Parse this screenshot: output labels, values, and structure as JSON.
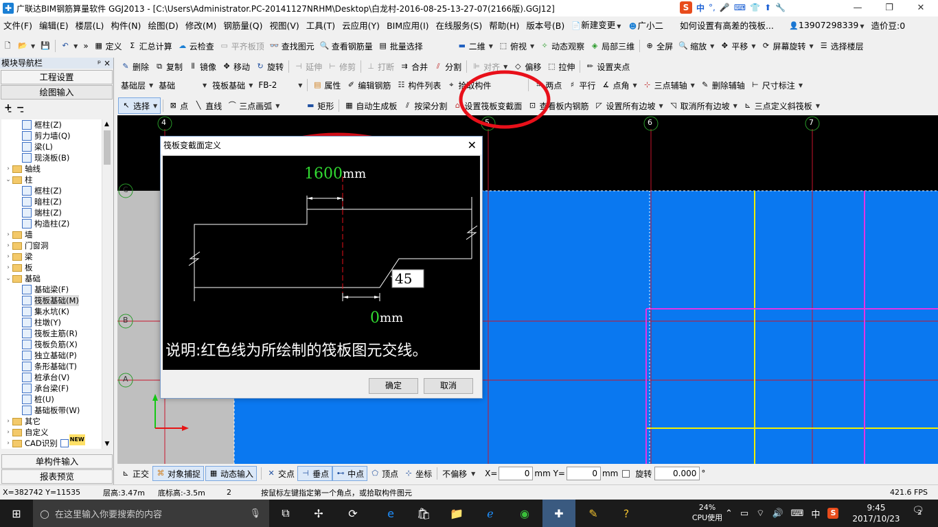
{
  "window": {
    "title": "广联达BIM钢筋算量软件 GGJ2013 - [C:\\Users\\Administrator.PC-20141127NRHM\\Desktop\\白龙村-2016-08-25-13-27-07(2166版).GGJ12]",
    "ime_label": "中"
  },
  "menu": {
    "items": [
      "文件(F)",
      "编辑(E)",
      "楼层(L)",
      "构件(N)",
      "绘图(D)",
      "修改(M)",
      "钢筋量(Q)",
      "视图(V)",
      "工具(T)",
      "云应用(Y)",
      "BIM应用(I)",
      "在线服务(S)",
      "帮助(H)",
      "版本号(B)"
    ],
    "new_change": "新建变更",
    "assistant": "广小二",
    "question": "如何设置有高差的筏板...",
    "phone": "13907298339",
    "price_bean": "造价豆:0"
  },
  "toolbar1": {
    "define": "定义",
    "sum_calc": "汇总计算",
    "cloud_check": "云检查",
    "flush_top": "平齐板顶",
    "find": "查找图元",
    "view_rebar": "查看钢筋量",
    "batch_select": "批量选择",
    "view_2d": "二维",
    "top_view": "俯视",
    "dynamic_view": "动态观察",
    "local_3d": "局部三维",
    "fullscreen": "全屏",
    "zoom": "缩放",
    "pan": "平移",
    "rotate_screen": "屏幕旋转",
    "select_floor": "选择楼层"
  },
  "toolbar2": {
    "delete": "删除",
    "copy": "复制",
    "mirror": "镜像",
    "move": "移动",
    "rotate": "旋转",
    "extend": "延伸",
    "trim": "修剪",
    "break": "打断",
    "merge": "合并",
    "split": "分割",
    "align": "对齐",
    "offset": "偏移",
    "stretch": "拉伸",
    "set_grip": "设置夹点"
  },
  "toolbar3": {
    "layer": "基础层",
    "category": "基础",
    "type": "筏板基础",
    "component": "FB-2",
    "properties": "属性",
    "edit_rebar": "编辑钢筋",
    "component_list": "构件列表",
    "pick_component": "拾取构件",
    "two_points": "两点",
    "parallel": "平行",
    "point_angle": "点角",
    "three_point_axis": "三点辅轴",
    "delete_axis": "删除辅轴",
    "dimension": "尺寸标注"
  },
  "toolbar4": {
    "select": "选择",
    "point": "点",
    "line": "直线",
    "arc3": "三点画弧",
    "rect": "矩形",
    "auto_gen": "自动生成板",
    "split_by": "按梁分割",
    "set_section": "设置筏板变截面",
    "view_slab_rebar": "查看板内钢筋",
    "set_all_slopes": "设置所有边坡",
    "cancel_all_slopes": "取消所有边坡",
    "three_point_slope": "三点定义斜筏板"
  },
  "panel": {
    "title": "模块导航栏",
    "pin": "ᵖ ×",
    "project_settings": "工程设置",
    "drawing_input": "绘图输入",
    "single_input": "单构件输入",
    "report_preview": "报表预览",
    "tree": [
      {
        "label": "框柱(Z)",
        "level": 2,
        "type": "leaf"
      },
      {
        "label": "剪力墙(Q)",
        "level": 2,
        "type": "leaf"
      },
      {
        "label": "梁(L)",
        "level": 2,
        "type": "leaf"
      },
      {
        "label": "现浇板(B)",
        "level": 2,
        "type": "leaf"
      },
      {
        "label": "轴线",
        "level": 1,
        "type": "folder",
        "toggle": "›"
      },
      {
        "label": "柱",
        "level": 1,
        "type": "folder",
        "toggle": "⌄"
      },
      {
        "label": "框柱(Z)",
        "level": 2,
        "type": "leaf"
      },
      {
        "label": "暗柱(Z)",
        "level": 2,
        "type": "leaf"
      },
      {
        "label": "端柱(Z)",
        "level": 2,
        "type": "leaf"
      },
      {
        "label": "构造柱(Z)",
        "level": 2,
        "type": "leaf"
      },
      {
        "label": "墙",
        "level": 1,
        "type": "folder",
        "toggle": "›"
      },
      {
        "label": "门窗洞",
        "level": 1,
        "type": "folder",
        "toggle": "›"
      },
      {
        "label": "梁",
        "level": 1,
        "type": "folder",
        "toggle": "›"
      },
      {
        "label": "板",
        "level": 1,
        "type": "folder",
        "toggle": "›"
      },
      {
        "label": "基础",
        "level": 1,
        "type": "folder",
        "toggle": "⌄"
      },
      {
        "label": "基础梁(F)",
        "level": 2,
        "type": "leaf"
      },
      {
        "label": "筏板基础(M)",
        "level": 2,
        "type": "leaf",
        "selected": true
      },
      {
        "label": "集水坑(K)",
        "level": 2,
        "type": "leaf"
      },
      {
        "label": "柱墩(Y)",
        "level": 2,
        "type": "leaf"
      },
      {
        "label": "筏板主筋(R)",
        "level": 2,
        "type": "leaf"
      },
      {
        "label": "筏板负筋(X)",
        "level": 2,
        "type": "leaf"
      },
      {
        "label": "独立基础(P)",
        "level": 2,
        "type": "leaf"
      },
      {
        "label": "条形基础(T)",
        "level": 2,
        "type": "leaf"
      },
      {
        "label": "桩承台(V)",
        "level": 2,
        "type": "leaf"
      },
      {
        "label": "承台梁(F)",
        "level": 2,
        "type": "leaf"
      },
      {
        "label": "桩(U)",
        "level": 2,
        "type": "leaf"
      },
      {
        "label": "基础板带(W)",
        "level": 2,
        "type": "leaf"
      },
      {
        "label": "其它",
        "level": 1,
        "type": "folder",
        "toggle": "›"
      },
      {
        "label": "自定义",
        "level": 1,
        "type": "folder",
        "toggle": "›"
      },
      {
        "label": "CAD识别",
        "level": 1,
        "type": "folder",
        "toggle": "›",
        "badge": "NEW"
      }
    ]
  },
  "canvas": {
    "axes_top": [
      "4",
      "5",
      "6",
      "7"
    ],
    "axes_left": [
      "C",
      "B",
      "A"
    ],
    "colors": {
      "slab": "#0a78f0",
      "grid_red": "#c8142d",
      "yellow": "#f0f000",
      "magenta": "#e632e6"
    }
  },
  "dialog": {
    "title": "筏板变截面定义",
    "top_value": "1600",
    "top_unit": "mm",
    "angle": "45",
    "bottom_value": "0",
    "bottom_unit": "mm",
    "note": "说明:红色线为所绘制的筏板图元交线。",
    "ok": "确定",
    "cancel": "取消"
  },
  "snap": {
    "ortho": "正交",
    "object_snap": "对象捕捉",
    "dynamic_input": "动态输入",
    "intersection": "交点",
    "perpendicular": "垂点",
    "midpoint": "中点",
    "vertex": "顶点",
    "coordinate": "坐标",
    "offset_mode": "不偏移",
    "x_label": "X=",
    "x_value": "0",
    "y_label": "mm Y=",
    "y_value": "0",
    "mm": "mm",
    "rotate": "旋转",
    "rotate_value": "0.000",
    "degree": "°"
  },
  "status": {
    "coords": "X=382742 Y=11535",
    "floor_height": "层高:3.47m",
    "bottom_elev": "底标高:-3.5m",
    "count": "2",
    "hint": "按鼠标左键指定第一个角点，或拾取构件图元",
    "fps": "421.6 FPS"
  },
  "taskbar": {
    "search_placeholder": "在这里输入你要搜索的内容",
    "cpu_percent": "24%",
    "cpu_label": "CPU使用",
    "ime": "中",
    "time": "9:45",
    "date": "2017/10/23",
    "notif_count": "2"
  }
}
